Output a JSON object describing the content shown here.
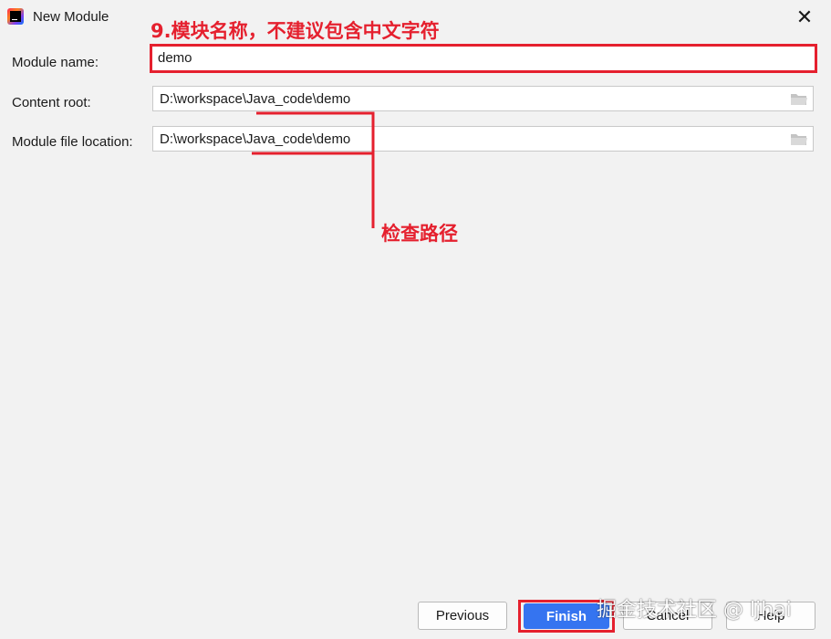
{
  "window": {
    "title": "New Module",
    "close_glyph": "✕"
  },
  "annotations": {
    "step_title": "9.模块名称，不建议包含中文字符",
    "check_path": "检查路径",
    "accent_color": "#e5202e"
  },
  "form": {
    "module_name": {
      "label": "Module name:",
      "value": "demo"
    },
    "content_root": {
      "label": "Content root:",
      "value": "D:\\workspace\\Java_code\\demo",
      "icon": "folder-icon"
    },
    "module_file_location": {
      "label": "Module file location:",
      "value": "D:\\workspace\\Java_code\\demo",
      "icon": "folder-icon"
    }
  },
  "buttons": {
    "previous": "Previous",
    "finish": "Finish",
    "cancel": "Cancel",
    "help": "Help",
    "primary_color": "#3574f0"
  },
  "watermark": "掘金技术社区 @ ljhai"
}
